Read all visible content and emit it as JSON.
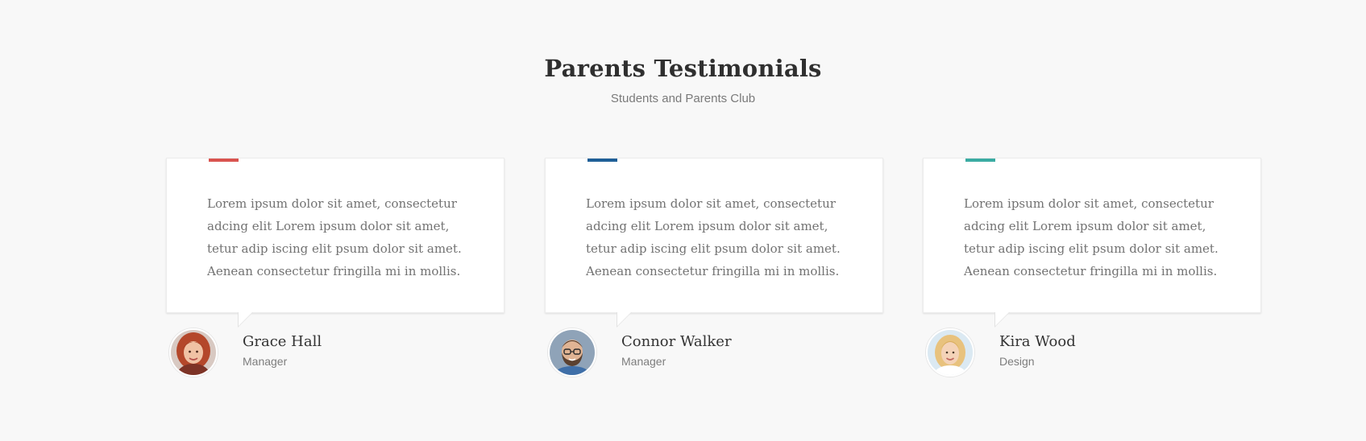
{
  "section": {
    "title": "Parents Testimonials",
    "subtitle": "Students and Parents Club"
  },
  "testimonials": [
    {
      "accent_color": "#d9534f",
      "quote": "Lorem ipsum dolor sit amet, consectetur adcing elit Lorem ipsum dolor sit amet, tetur adip iscing elit psum dolor sit  amet. Aenean consectetur fringilla mi in mollis.",
      "name": "Grace Hall",
      "role": "Manager",
      "avatar_icon": "avatar-red-hair-woman"
    },
    {
      "accent_color": "#1f5f97",
      "quote": "Lorem ipsum dolor sit amet, consectetur adcing elit Lorem ipsum dolor sit amet, tetur adip iscing elit psum dolor sit  amet. Aenean consectetur fringilla mi in mollis.",
      "name": "Connor Walker",
      "role": "Manager",
      "avatar_icon": "avatar-bearded-man-glasses"
    },
    {
      "accent_color": "#3aaba2",
      "quote": "Lorem ipsum dolor sit amet, consectetur adcing elit Lorem ipsum dolor sit amet, tetur adip iscing elit psum dolor sit  amet. Aenean consectetur fringilla mi in mollis.",
      "name": "Kira Wood",
      "role": "Design",
      "avatar_icon": "avatar-blonde-woman"
    }
  ]
}
